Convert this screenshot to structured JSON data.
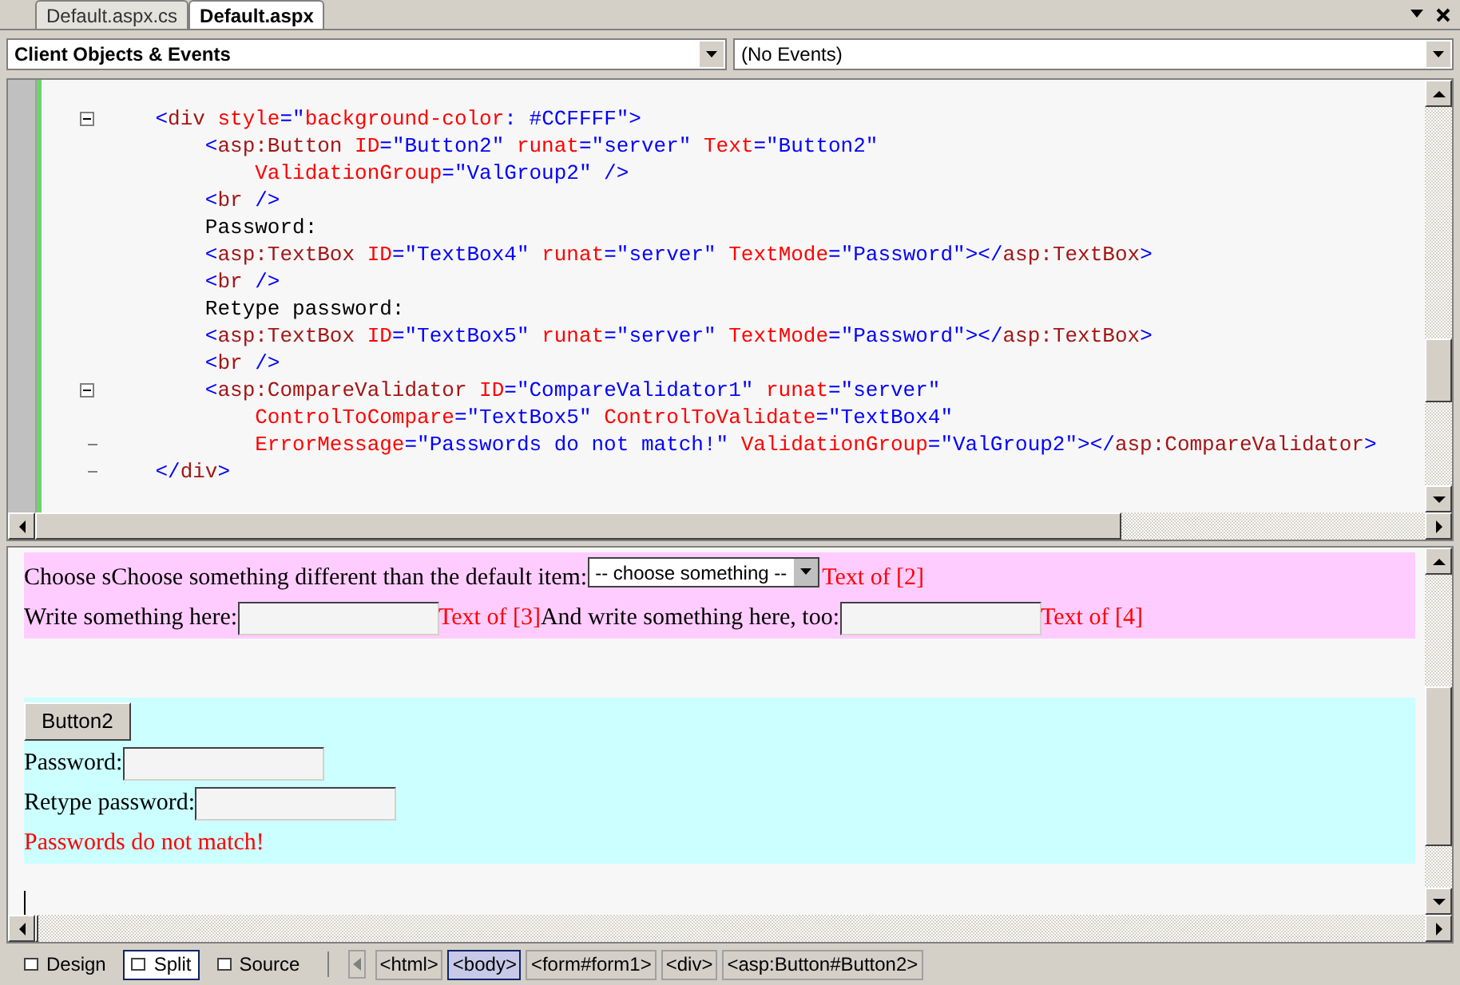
{
  "tabs": [
    {
      "label": "Default.aspx.cs",
      "selected": false
    },
    {
      "label": "Default.aspx",
      "selected": true
    }
  ],
  "toolbar": {
    "objects_dropdown": {
      "value": "Client Objects & Events"
    },
    "events_dropdown": {
      "value": "(No Events)"
    }
  },
  "code_lines": [
    {
      "collapse_box": true,
      "tokens": [
        {
          "kind": "punct",
          "text": "    <"
        },
        {
          "kind": "tag",
          "text": "div"
        },
        {
          "kind": "attr",
          "text": " style"
        },
        {
          "kind": "punct",
          "text": "=\""
        },
        {
          "kind": "attr",
          "text": "background-color"
        },
        {
          "kind": "punct",
          "text": ": #CCFFFF\">"
        }
      ]
    },
    {
      "tokens": [
        {
          "kind": "punct",
          "text": "        <"
        },
        {
          "kind": "tag",
          "text": "asp:Button"
        },
        {
          "kind": "attr",
          "text": " ID"
        },
        {
          "kind": "punct",
          "text": "=\"Button2\""
        },
        {
          "kind": "attr",
          "text": " runat"
        },
        {
          "kind": "punct",
          "text": "=\"server\""
        },
        {
          "kind": "attr",
          "text": " Text"
        },
        {
          "kind": "punct",
          "text": "=\"Button2\""
        }
      ]
    },
    {
      "tokens": [
        {
          "kind": "attr",
          "text": "            ValidationGroup"
        },
        {
          "kind": "punct",
          "text": "=\"ValGroup2\" />"
        }
      ]
    },
    {
      "tokens": [
        {
          "kind": "punct",
          "text": "        <"
        },
        {
          "kind": "tag",
          "text": "br"
        },
        {
          "kind": "punct",
          "text": " />"
        }
      ]
    },
    {
      "tokens": [
        {
          "kind": "text",
          "text": "        Password:"
        }
      ]
    },
    {
      "tokens": [
        {
          "kind": "punct",
          "text": "        <"
        },
        {
          "kind": "tag",
          "text": "asp:TextBox"
        },
        {
          "kind": "attr",
          "text": " ID"
        },
        {
          "kind": "punct",
          "text": "=\"TextBox4\""
        },
        {
          "kind": "attr",
          "text": " runat"
        },
        {
          "kind": "punct",
          "text": "=\"server\""
        },
        {
          "kind": "attr",
          "text": " TextMode"
        },
        {
          "kind": "punct",
          "text": "=\"Password\"></"
        },
        {
          "kind": "tag",
          "text": "asp:TextBox"
        },
        {
          "kind": "punct",
          "text": ">"
        }
      ]
    },
    {
      "tokens": [
        {
          "kind": "punct",
          "text": "        <"
        },
        {
          "kind": "tag",
          "text": "br"
        },
        {
          "kind": "punct",
          "text": " />"
        }
      ]
    },
    {
      "tokens": [
        {
          "kind": "text",
          "text": "        Retype password:"
        }
      ]
    },
    {
      "tokens": [
        {
          "kind": "punct",
          "text": "        <"
        },
        {
          "kind": "tag",
          "text": "asp:TextBox"
        },
        {
          "kind": "attr",
          "text": " ID"
        },
        {
          "kind": "punct",
          "text": "=\"TextBox5\""
        },
        {
          "kind": "attr",
          "text": " runat"
        },
        {
          "kind": "punct",
          "text": "=\"server\""
        },
        {
          "kind": "attr",
          "text": " TextMode"
        },
        {
          "kind": "punct",
          "text": "=\"Password\"></"
        },
        {
          "kind": "tag",
          "text": "asp:TextBox"
        },
        {
          "kind": "punct",
          "text": ">"
        }
      ]
    },
    {
      "tokens": [
        {
          "kind": "punct",
          "text": "        <"
        },
        {
          "kind": "tag",
          "text": "br"
        },
        {
          "kind": "punct",
          "text": " />"
        }
      ]
    },
    {
      "collapse_box": true,
      "tokens": [
        {
          "kind": "punct",
          "text": "        <"
        },
        {
          "kind": "tag",
          "text": "asp:CompareValidator"
        },
        {
          "kind": "attr",
          "text": " ID"
        },
        {
          "kind": "punct",
          "text": "=\"CompareValidator1\""
        },
        {
          "kind": "attr",
          "text": " runat"
        },
        {
          "kind": "punct",
          "text": "=\"server\""
        }
      ]
    },
    {
      "tokens": [
        {
          "kind": "attr",
          "text": "            ControlToCompare"
        },
        {
          "kind": "punct",
          "text": "=\"TextBox5\""
        },
        {
          "kind": "attr",
          "text": " ControlToValidate"
        },
        {
          "kind": "punct",
          "text": "=\"TextBox4\""
        }
      ]
    },
    {
      "fold_end": true,
      "tokens": [
        {
          "kind": "attr",
          "text": "            ErrorMessage"
        },
        {
          "kind": "punct",
          "text": "=\"Passwords do not match!\""
        },
        {
          "kind": "attr",
          "text": " ValidationGroup"
        },
        {
          "kind": "punct",
          "text": "=\"ValGroup2\"></"
        },
        {
          "kind": "tag",
          "text": "asp:CompareValidator"
        },
        {
          "kind": "punct",
          "text": ">"
        }
      ]
    },
    {
      "fold_end": true,
      "tokens": [
        {
          "kind": "punct",
          "text": "    </"
        },
        {
          "kind": "tag",
          "text": "div"
        },
        {
          "kind": "punct",
          "text": ">"
        }
      ]
    }
  ],
  "design": {
    "sections": [
      {
        "color": "#ffccff",
        "lines": [
          {
            "items": [
              {
                "kind": "text",
                "text": "Choose sChoose something different than the default item:"
              },
              {
                "kind": "select",
                "text": "-- choose something --"
              },
              {
                "kind": "error",
                "text": "Text of [2]"
              }
            ]
          },
          {
            "items": [
              {
                "kind": "text",
                "text": "Write something here:"
              },
              {
                "kind": "input"
              },
              {
                "kind": "error",
                "text": "Text of [3]"
              },
              {
                "kind": "text",
                "text": "And write something here, too:"
              },
              {
                "kind": "input"
              },
              {
                "kind": "error",
                "text": "Text of [4]"
              }
            ]
          }
        ]
      },
      {
        "color": "#ccffff",
        "lines": [
          {
            "items": [
              {
                "kind": "button",
                "text": "Button2"
              }
            ]
          },
          {
            "items": [
              {
                "kind": "text",
                "text": "Password:"
              },
              {
                "kind": "input"
              }
            ]
          },
          {
            "items": [
              {
                "kind": "text",
                "text": "Retype password:"
              },
              {
                "kind": "input"
              }
            ]
          },
          {
            "items": [
              {
                "kind": "error",
                "text": "Passwords do not match!"
              }
            ]
          }
        ]
      }
    ]
  },
  "view_buttons": [
    {
      "label": "Design",
      "selected": false
    },
    {
      "label": "Split",
      "selected": true
    },
    {
      "label": "Source",
      "selected": false
    }
  ],
  "breadcrumbs": [
    {
      "label": "<html>",
      "selected": false
    },
    {
      "label": "<body>",
      "selected": true
    },
    {
      "label": "<form#form1>",
      "selected": false
    },
    {
      "label": "<div>",
      "selected": false
    },
    {
      "label": "<asp:Button#Button2>",
      "selected": false
    }
  ]
}
